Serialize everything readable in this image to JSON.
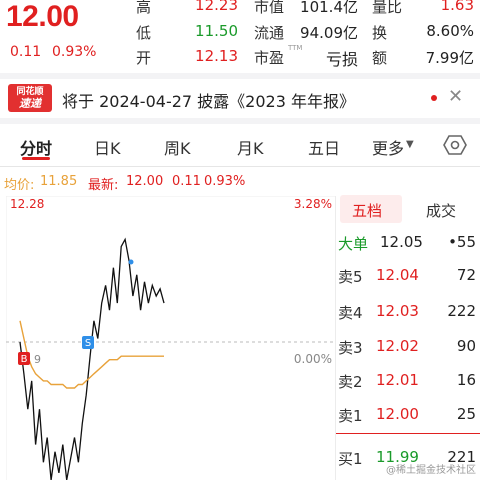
{
  "quote": {
    "price": "12.00",
    "change": "0.11",
    "change_pct": "0.93%",
    "stats_col1": [
      {
        "label": "高",
        "value": "12.23",
        "color": "#e02020"
      },
      {
        "label": "低",
        "value": "11.50",
        "color": "#1a9a2a"
      },
      {
        "label": "开",
        "value": "12.13",
        "color": "#e02020"
      }
    ],
    "stats_col2": [
      {
        "label": "市值",
        "value": "101.4亿"
      },
      {
        "label": "流通",
        "value": "94.09亿"
      },
      {
        "label": "市盈",
        "sup": "TTM",
        "value": "亏损"
      }
    ],
    "stats_col3": [
      {
        "label": "量比",
        "value": "1.63",
        "color": "#e02020"
      },
      {
        "label": "换",
        "value": "8.60%"
      },
      {
        "label": "额",
        "value": "7.99亿"
      }
    ]
  },
  "news": {
    "badge_line1": "同花顺",
    "badge_line2": "速递",
    "text": "将于 2024-04-27 披露《2023 年年报》",
    "close_icon": "close-icon"
  },
  "tabs": [
    "分时",
    "日K",
    "周K",
    "月K",
    "五日",
    "更多"
  ],
  "active_tab": "分时",
  "info": {
    "avg_label": "均价:",
    "avg_value": "11.85",
    "latest_label": "最新:",
    "latest_value": "12.00",
    "latest_change": "0.11",
    "latest_pct": "0.93%"
  },
  "chart_data": {
    "type": "line",
    "y_top_label": "12.28",
    "y_top_pct": "3.28%",
    "baseline_pct": "0.00%",
    "baseline_price_partial": "9",
    "ylim": [
      11.5,
      12.28
    ],
    "baseline": 11.89,
    "series": [
      {
        "color": "#111111",
        "values": [
          11.89,
          11.8,
          11.7,
          11.78,
          11.6,
          11.7,
          11.55,
          11.62,
          11.5,
          11.58,
          11.52,
          11.6,
          11.5,
          11.56,
          11.62,
          11.55,
          11.66,
          11.74,
          11.85,
          11.95,
          11.9,
          12.0,
          12.05,
          11.98,
          12.1,
          12.0,
          12.16,
          12.18,
          12.12,
          12.02,
          12.08,
          11.98,
          12.06,
          12.0,
          12.05,
          12.02,
          12.04,
          12.0
        ]
      },
      {
        "color": "#e8a23a",
        "values": [
          11.95,
          11.9,
          11.85,
          11.82,
          11.8,
          11.79,
          11.78,
          11.78,
          11.77,
          11.77,
          11.77,
          11.77,
          11.76,
          11.76,
          11.76,
          11.77,
          11.77,
          11.78,
          11.79,
          11.8,
          11.81,
          11.82,
          11.83,
          11.84,
          11.84,
          11.84,
          11.85,
          11.85,
          11.85,
          11.85,
          11.85,
          11.85,
          11.85,
          11.85,
          11.85,
          11.85,
          11.85,
          11.85
        ]
      }
    ],
    "markers": [
      {
        "label": "B",
        "color": "#e02020"
      },
      {
        "label": "S",
        "color": "#2f8fe8"
      }
    ]
  },
  "orderbook": {
    "tabs": [
      "五档",
      "成交"
    ],
    "big_order": {
      "label": "大单",
      "price": "12.05",
      "vol": "•55"
    },
    "asks": [
      {
        "label": "卖5",
        "price": "12.04",
        "vol": "72"
      },
      {
        "label": "卖4",
        "price": "12.03",
        "vol": "222"
      },
      {
        "label": "卖3",
        "price": "12.02",
        "vol": "90"
      },
      {
        "label": "卖2",
        "price": "12.01",
        "vol": "16"
      },
      {
        "label": "卖1",
        "price": "12.00",
        "vol": "25"
      }
    ],
    "bids": [
      {
        "label": "买1",
        "price": "11.99",
        "vol": "221"
      }
    ]
  },
  "watermark": "@稀土掘金技术社区",
  "colors": {
    "up": "#e02020",
    "down": "#1a9a2a",
    "avg_line": "#e8a23a",
    "price_line": "#111111"
  }
}
